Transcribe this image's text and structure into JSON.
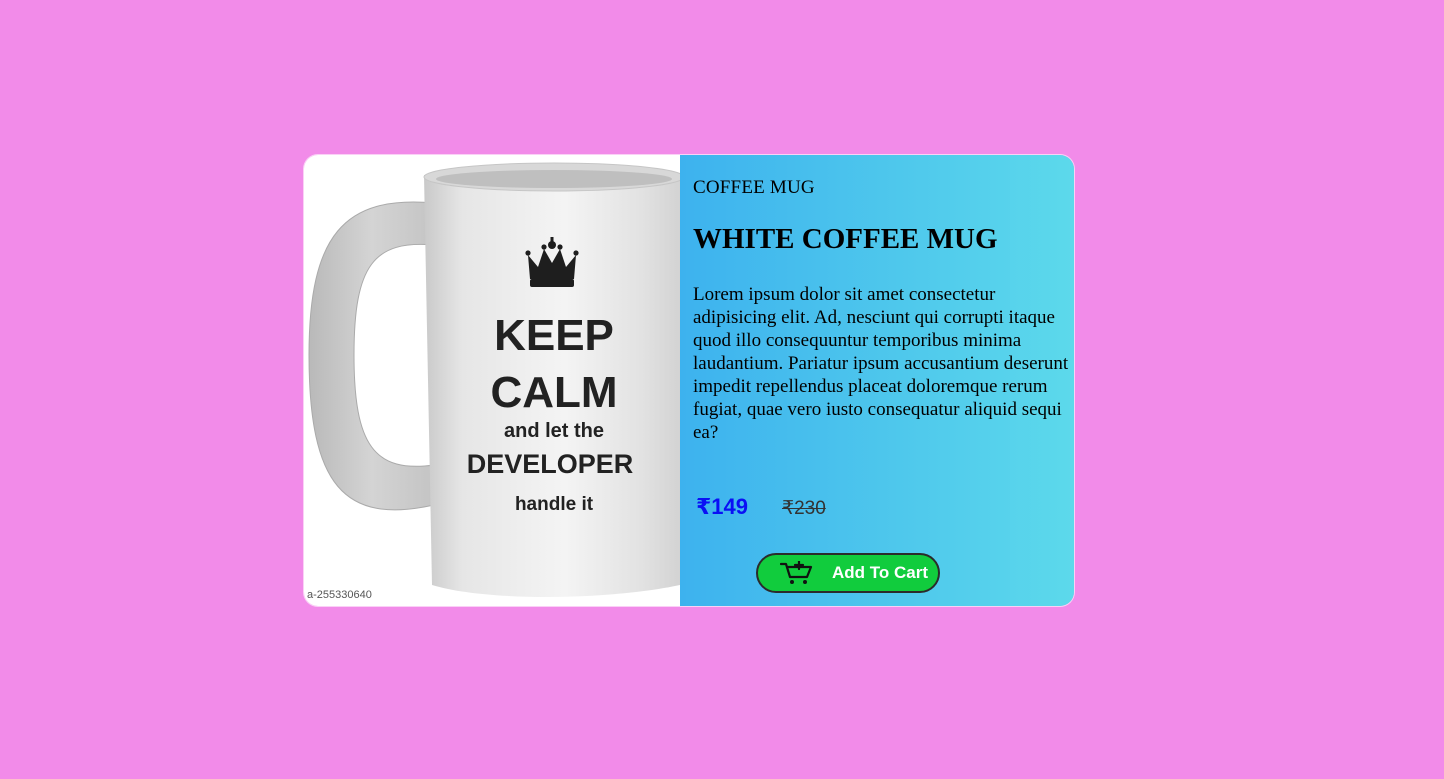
{
  "colors": {
    "page_background": "#f28be9",
    "panel_gradient_start": "#3db2ee",
    "panel_gradient_end": "#5cd9eb",
    "price_accent": "#0a10f5",
    "button_background": "#11cc3d"
  },
  "product": {
    "category": "COFFEE MUG",
    "title": "WHITE COFFEE MUG",
    "description": "Lorem ipsum dolor sit amet consectetur adipisicing elit. Ad, nesciunt qui corrupti itaque quod illo consequuntur temporibus minima laudantium. Pariatur ipsum accusantium deserunt impedit repellendus placeat doloremque rerum fugiat, quae vero iusto consequatur aliquid sequi ea?",
    "price": "₹149",
    "original_price": "₹230",
    "image": {
      "icon": "crown-icon",
      "line1": "KEEP",
      "line2": "CALM",
      "line3": "and let the",
      "line4": "DEVELOPER",
      "line5": "handle it",
      "watermark": "a-255330640"
    }
  },
  "cart_button": {
    "label": "Add To Cart",
    "icon": "cart-icon"
  }
}
